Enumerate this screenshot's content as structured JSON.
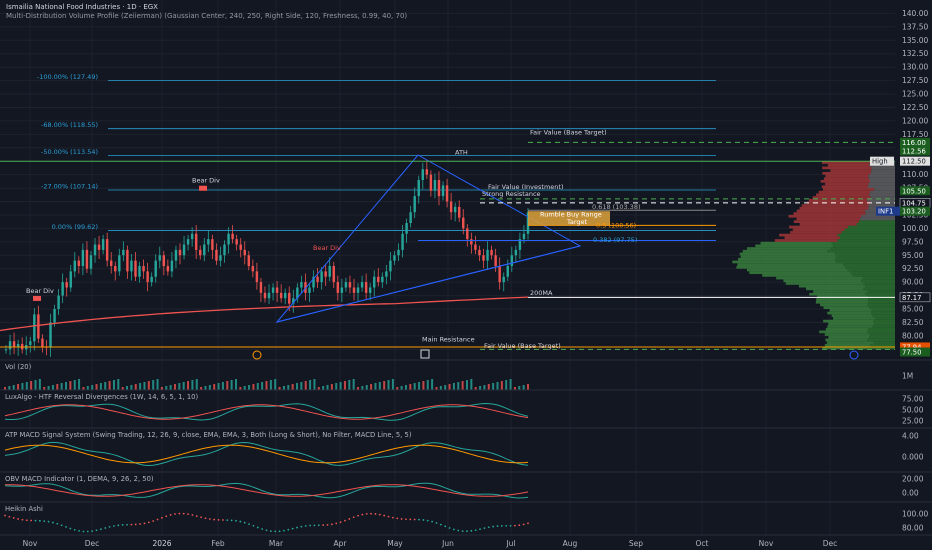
{
  "header": {
    "title": "Ismailia National Food Industries · 1D · EGX",
    "indicator": "Multi-Distribution Volume Profile (Zeiierman) (Gaussian Center, 240, 250, Right Side, 120, Freshness, 0.99, 40, 70)"
  },
  "colors": {
    "background": "#131722",
    "up": "#26a69a",
    "down": "#ef5350",
    "fib": "#2a9fd6",
    "triangle": "#2962ff",
    "ma": "#ef5350",
    "fair_value": "#4caf50",
    "orange": "#ff9800"
  },
  "chart_data": [
    {
      "type": "candlestick",
      "title": "Ismailia National Food Industries · 1D · EGX",
      "x_months": [
        "Nov",
        "Dec",
        "2026",
        "Feb",
        "Mar",
        "Apr",
        "May",
        "Jun",
        "Jul",
        "Aug",
        "Sep",
        "Oct",
        "Nov",
        "Dec"
      ],
      "y_ticks": [
        "140.00",
        "137.50",
        "135.00",
        "132.50",
        "130.00",
        "127.50",
        "125.00",
        "122.50",
        "120.00",
        "117.50",
        "115.00",
        "112.50",
        "110.00",
        "107.50",
        "105.00",
        "102.50",
        "100.00",
        "97.50",
        "95.00",
        "92.50",
        "90.00",
        "87.50",
        "85.00",
        "82.50",
        "80.00",
        "77.50"
      ],
      "ylim": [
        77,
        141
      ],
      "closes": [
        77.5,
        79,
        78,
        78.5,
        77.5,
        78.3,
        79,
        84,
        79.5,
        78,
        77.8,
        82.5,
        85,
        87.5,
        90,
        89,
        92,
        94,
        93,
        96,
        92.5,
        95,
        97,
        96,
        98,
        94,
        93,
        92,
        95,
        96,
        92,
        94,
        91,
        93,
        92,
        90,
        91,
        94,
        95,
        93,
        92,
        94,
        96,
        95,
        97,
        98,
        99,
        96,
        95,
        97,
        98,
        96,
        94,
        95,
        97,
        99,
        98,
        97,
        96,
        95,
        93,
        92,
        90,
        88,
        87,
        88,
        89,
        88,
        87,
        88,
        86,
        87,
        89,
        90,
        88,
        89,
        91,
        90,
        92,
        91,
        93,
        90,
        88,
        89,
        90,
        89,
        88,
        89,
        90,
        88,
        89,
        91,
        90,
        91,
        92,
        94,
        95,
        96,
        99,
        101,
        103,
        106,
        109,
        111,
        110,
        107,
        109,
        106,
        108,
        105,
        103,
        104,
        102,
        100,
        98,
        97,
        96,
        95,
        94,
        96,
        95,
        93,
        90,
        91,
        93,
        95,
        96,
        98,
        99,
        103
      ],
      "price_labels": [
        {
          "text": "116.00",
          "color": "#43a047"
        },
        {
          "text": "112.56",
          "color": "#43a047"
        },
        {
          "text": "112.50",
          "color": "#131722"
        },
        {
          "text": "High",
          "color": "#131722"
        },
        {
          "text": "105.50",
          "color": "#43a047"
        },
        {
          "text": "104.75",
          "color": "#ffffff"
        },
        {
          "text": "103.20",
          "color": "#26a69a"
        },
        {
          "text": "INF1",
          "color": "#2962ff"
        },
        {
          "text": "87.17",
          "color": "#ffffff"
        },
        {
          "text": "77.94",
          "color": "#ff9800"
        },
        {
          "text": "77.50",
          "color": "#43a047"
        }
      ],
      "fib_levels": [
        {
          "label": "-100.00% (127.49)",
          "value": 127.49
        },
        {
          "label": "-68.00% (118.55)",
          "value": 118.55
        },
        {
          "label": "-50.00% (113.54)",
          "value": 113.54
        },
        {
          "label": "-27.00% (107.14)",
          "value": 107.14
        },
        {
          "label": "0.00% (99.62)",
          "value": 99.62
        }
      ],
      "annotations": [
        {
          "text": "ATH"
        },
        {
          "text": "Fair Value (Base Target)"
        },
        {
          "text": "Fair Value (Investment)"
        },
        {
          "text": "Strong Resistance"
        },
        {
          "text": "0.618 (103.38)"
        },
        {
          "text": "Rumble Buy Range"
        },
        {
          "text": "Target"
        },
        {
          "text": "0.5 (100.56)"
        },
        {
          "text": "0.382 (97.75)"
        },
        {
          "text": "200MA"
        },
        {
          "text": "Main Resistance"
        },
        {
          "text": "Fair Value (Base Target)"
        },
        {
          "text": "Bear Div"
        },
        {
          "text": "Bear Div"
        },
        {
          "text": "Bear Div"
        }
      ]
    },
    {
      "type": "bar",
      "title": "Vol (20)",
      "y_ticks": [
        "1M"
      ]
    },
    {
      "type": "line",
      "title": "LuxAlgo - HTF Reversal Divergences (1W, 14, 6, 5, 1, 10)",
      "y_ticks": [
        "75.00",
        "50.00",
        "25.00"
      ]
    },
    {
      "type": "line",
      "title": "ATP MACD Signal System (Swing Trading, 12, 26, 9, close, EMA, EMA, 3, Both (Long & Short), No Filter, MACD Line, 5, 5)",
      "y_ticks": [
        "4.00",
        "0.000"
      ]
    },
    {
      "type": "line",
      "title": "OBV MACD Indicator (1, DEMA, 9, 26, 2, 50)",
      "y_ticks": [
        "20.00",
        "0.00"
      ]
    },
    {
      "type": "line",
      "title": "Heikin Ashi",
      "y_ticks": [
        "100.00",
        "80.00"
      ]
    }
  ]
}
